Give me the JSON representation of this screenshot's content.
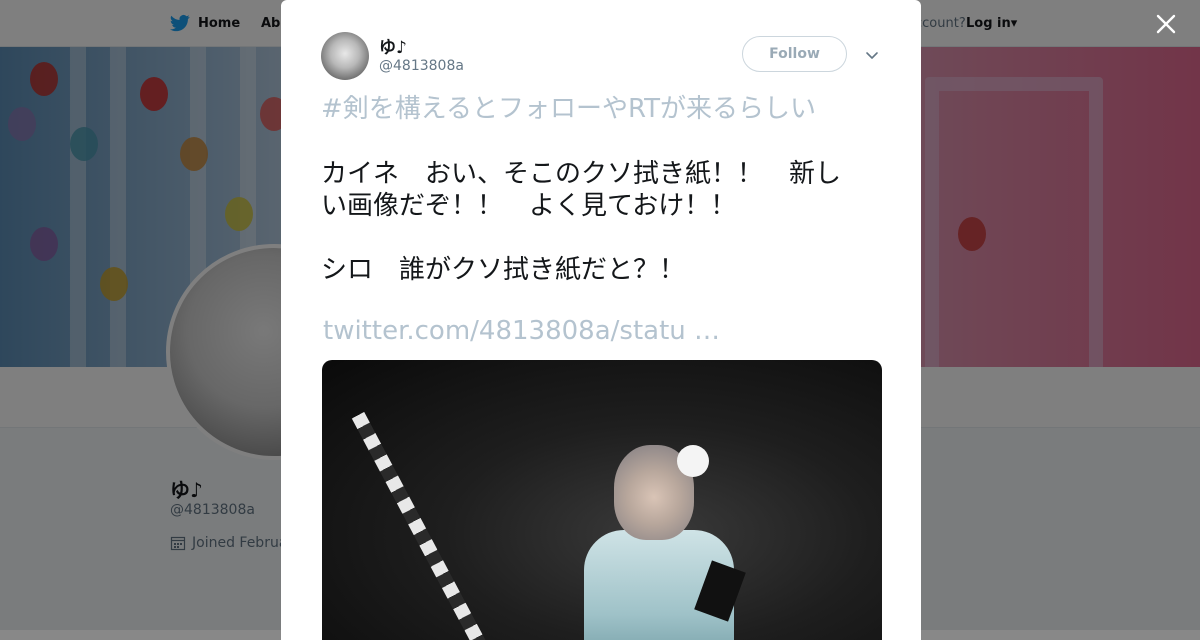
{
  "topbar": {
    "home_label": "Home",
    "about_label": "Abo",
    "account_text": "ccount?",
    "login_label": "Log in"
  },
  "profile": {
    "name": "ゆ♪",
    "handle": "@4813808a",
    "joined": "Joined Februa"
  },
  "tweet": {
    "author_name": "ゆ♪",
    "author_handle": "@4813808a",
    "follow_label": "Follow",
    "hashtag": "#剣を構えるとフォローやRTが来るらしい",
    "lines": [
      "カイネ　おい、そこのクソ拭き紙！！　新し",
      "い画像だぞ！！　よく見ておけ！！",
      "シロ　誰がクソ拭き紙だと？！"
    ],
    "link": "twitter.com/4813808a/statu …"
  },
  "icons": {
    "brand": "twitter-bird-icon",
    "close": "close-icon",
    "caret": "chevron-down-icon",
    "calendar": "calendar-icon"
  },
  "colors": {
    "brand": "#1da1f2",
    "muted_link": "#b4c3cf",
    "text": "#14171a",
    "secondary": "#657786"
  }
}
